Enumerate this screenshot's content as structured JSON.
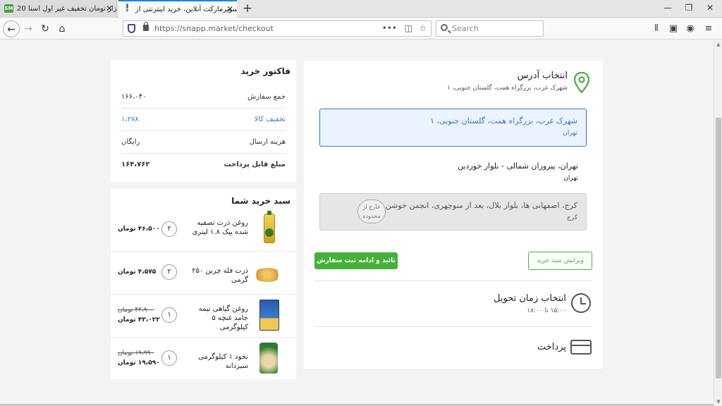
{
  "browser": {
    "tabs": [
      {
        "title": "20 هزار تومان تخفیف غیر اول اسنا",
        "favicon": "snapp-icon"
      },
      {
        "title": "سوپرمارکت آنلاین، خرید اینترنتی از",
        "favicon": "exclamation-icon"
      }
    ],
    "url": "https://snapp.market/checkout",
    "search_placeholder": "Search"
  },
  "invoice": {
    "title": "فاکتور خرید",
    "rows": [
      {
        "label": "جمع سفارش",
        "value": "۱۶۶،۰۴۰"
      },
      {
        "label": "تخفیف کالا",
        "value": "۱،۲۷۸"
      },
      {
        "label": "هزینه ارسال",
        "value": "رایگان"
      },
      {
        "label": "مبلغ قابل پرداخت",
        "value": "۱۶۴،۷۶۲"
      }
    ]
  },
  "cart": {
    "title": "سبد خرید شما",
    "items": [
      {
        "name": "روغن ذرت تصفیه شده پیک ۱.۸ لیتری",
        "qty": "۲",
        "price": "۴۶،۵۰۰ تومان",
        "old_price": ""
      },
      {
        "name": "ذرت فله چربن ۲۵۰ گرمی",
        "qty": "۲",
        "price": "۴،۵۷۵ تومان",
        "old_price": ""
      },
      {
        "name": "روغن گیاهی نیمه جامد غنچه ۵ کیلوگرمی",
        "qty": "۱",
        "price": "۴۳،۰۲۲ تومان",
        "old_price": "۴۳،۹۰۰ تومان"
      },
      {
        "name": "نخود ۱ کیلوگرمی سبزدانه",
        "qty": "۱",
        "price": "۱۹،۵۹۰ تومان",
        "old_price": "۱۹،۹۹۰ تومان"
      }
    ]
  },
  "address": {
    "title": "انتخاب آدرس",
    "current": "شهرک غرب، بزرگراه همت، گلستان جنوبی، ۱",
    "options": [
      {
        "line1": "شهرک غرب، بزرگراه همت، گلستان جنوبی، ۱",
        "city": "تهران"
      },
      {
        "line1": "تهران، پیروزان شمالی - بلوار خوردین",
        "city": "تهران"
      },
      {
        "line1": "کرج، اصفهانی ها، بلوار بلال، بعد از منوچهری، انجمن خوشن...",
        "city": "کرج"
      }
    ],
    "out_of_range_badge": "خارج از محدوده",
    "confirm_button": "تائید و ادامه ثبت سفارش",
    "edit_button": "ویرایش سبد خرید"
  },
  "delivery": {
    "title": "انتخاب زمان تحویل",
    "time": "۱۵:۰۰ تا ۱۸:۰۰"
  },
  "payment": {
    "title": "پرداخت"
  },
  "colors": {
    "accent_green": "#46b139",
    "selected_blue": "#2e7cd1"
  }
}
